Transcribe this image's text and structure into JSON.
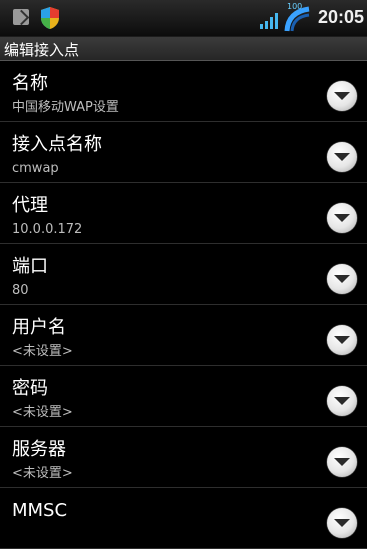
{
  "status_bar": {
    "time": "20:05",
    "battery_label": "100",
    "icons": [
      "screenshot-icon",
      "shield-icon",
      "signal-icon",
      "battery-icon"
    ]
  },
  "title": "编辑接入点",
  "settings": [
    {
      "label": "名称",
      "value": "中国移动WAP设置"
    },
    {
      "label": "接入点名称",
      "value": "cmwap"
    },
    {
      "label": "代理",
      "value": "10.0.0.172"
    },
    {
      "label": "端口",
      "value": "80"
    },
    {
      "label": "用户名",
      "value": "<未设置>"
    },
    {
      "label": "密码",
      "value": "<未设置>"
    },
    {
      "label": "服务器",
      "value": "<未设置>"
    },
    {
      "label": "MMSC",
      "value": ""
    }
  ],
  "colors": {
    "background": "#000000",
    "title_bar": "#2f2f2f",
    "divider": "#2e2e2e",
    "secondary_text": "#bdbdbd"
  }
}
